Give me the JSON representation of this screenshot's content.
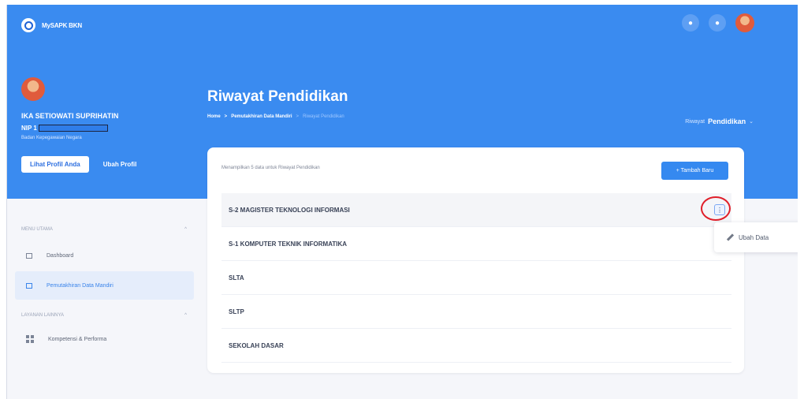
{
  "app": {
    "title": "MySAPK BKN"
  },
  "topbar": {
    "notification_label": "●",
    "bell_label": "●"
  },
  "profile": {
    "name": "IKA SETIOWATI SUPRIHATIN",
    "nip_prefix": "NIP 1",
    "organization": "Badan Kepegawaian Negara",
    "view_profile_label": "Lihat Profil Anda",
    "edit_profile_label": "Ubah Profil"
  },
  "page": {
    "title": "Riwayat Pendidikan",
    "breadcrumb": [
      "Home",
      ">",
      "Pemutakhiran Data Mandiri",
      ">",
      "Riwayat Pendidikan"
    ],
    "section_prefix": "Riwayat",
    "section_label": "Pendidikan",
    "section_caret": "⌄"
  },
  "sidebar": {
    "main_menu_label": "MENU UTAMA",
    "other_services_label": "LAYANAN LAINNYA",
    "collapse_icon": "^",
    "items": [
      {
        "label": "Dashboard",
        "icon": "dashboard-icon"
      },
      {
        "label": "Pemutakhiran Data Mandiri",
        "icon": "data-icon",
        "active": true
      },
      {
        "label": "Kompetensi & Performa",
        "icon": "performance-icon"
      }
    ]
  },
  "card": {
    "summary": "Menampilkan 5 data untuk Riwayat Pendidikan",
    "add_button": "+ Tambah Baru",
    "rows": [
      {
        "label": "S-2 MAGISTER TEKNOLOGI INFORMASI"
      },
      {
        "label": "S-1 KOMPUTER TEKNIK INFORMATIKA"
      },
      {
        "label": "SLTA"
      },
      {
        "label": "SLTP"
      },
      {
        "label": "SEKOLAH DASAR"
      }
    ]
  },
  "dropdown": {
    "edit_label": "Ubah Data"
  },
  "colors": {
    "primary": "#3A8BF0",
    "highlight": "#E01F2A",
    "background": "#F5F6FA"
  }
}
